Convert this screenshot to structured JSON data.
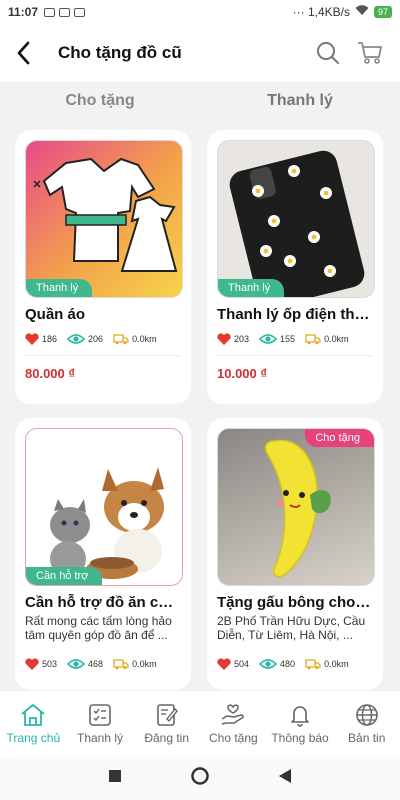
{
  "status": {
    "time": "11:07",
    "net": "··· 1,4KB/s",
    "battery": "97"
  },
  "header": {
    "title": "Cho tặng đồ cũ",
    "back_icon": "chevron-left-icon",
    "search_icon": "search-icon",
    "cart_icon": "cart-icon"
  },
  "tabs": [
    {
      "label": "Cho tặng"
    },
    {
      "label": "Thanh lý"
    }
  ],
  "colors": {
    "accent": "#2bb5a7",
    "price": "#d32f2f",
    "tag_green": "#3fb88f",
    "tag_pink": "#e7427a"
  },
  "products": [
    {
      "title": "Quần áo",
      "tag": "Thanh lý",
      "likes": "186",
      "views": "206",
      "distance": "0.0km",
      "price": "80.000 ₫",
      "desc": ""
    },
    {
      "title": "Thanh lý ốp điện tho...",
      "tag": "Thanh lý",
      "likes": "203",
      "views": "155",
      "distance": "0.0km",
      "price": "10.000 ₫",
      "desc": ""
    },
    {
      "title": "Cần hỗ trợ đồ ăn cho...",
      "tag": "Cần hỗ trợ",
      "likes": "503",
      "views": "468",
      "distance": "0.0km",
      "price": "",
      "desc": "Rất mong các tấm lòng hảo tâm quyên góp đồ ăn để ..."
    },
    {
      "title": "Tặng gấu bông cho bé",
      "tag": "Cho tặng",
      "likes": "504",
      "views": "480",
      "distance": "0.0km",
      "price": "",
      "desc": "2B Phố Trần Hữu Dực, Cầu Diễn, Từ Liêm, Hà Nội, ..."
    }
  ],
  "bottom_nav": [
    {
      "label": "Trang chủ",
      "icon": "home-icon"
    },
    {
      "label": "Thanh lý",
      "icon": "checklist-icon"
    },
    {
      "label": "Đăng tin",
      "icon": "edit-icon"
    },
    {
      "label": "Cho tặng",
      "icon": "gift-hand-icon"
    },
    {
      "label": "Thông báo",
      "icon": "bell-icon"
    },
    {
      "label": "Bản tin",
      "icon": "globe-icon"
    }
  ]
}
